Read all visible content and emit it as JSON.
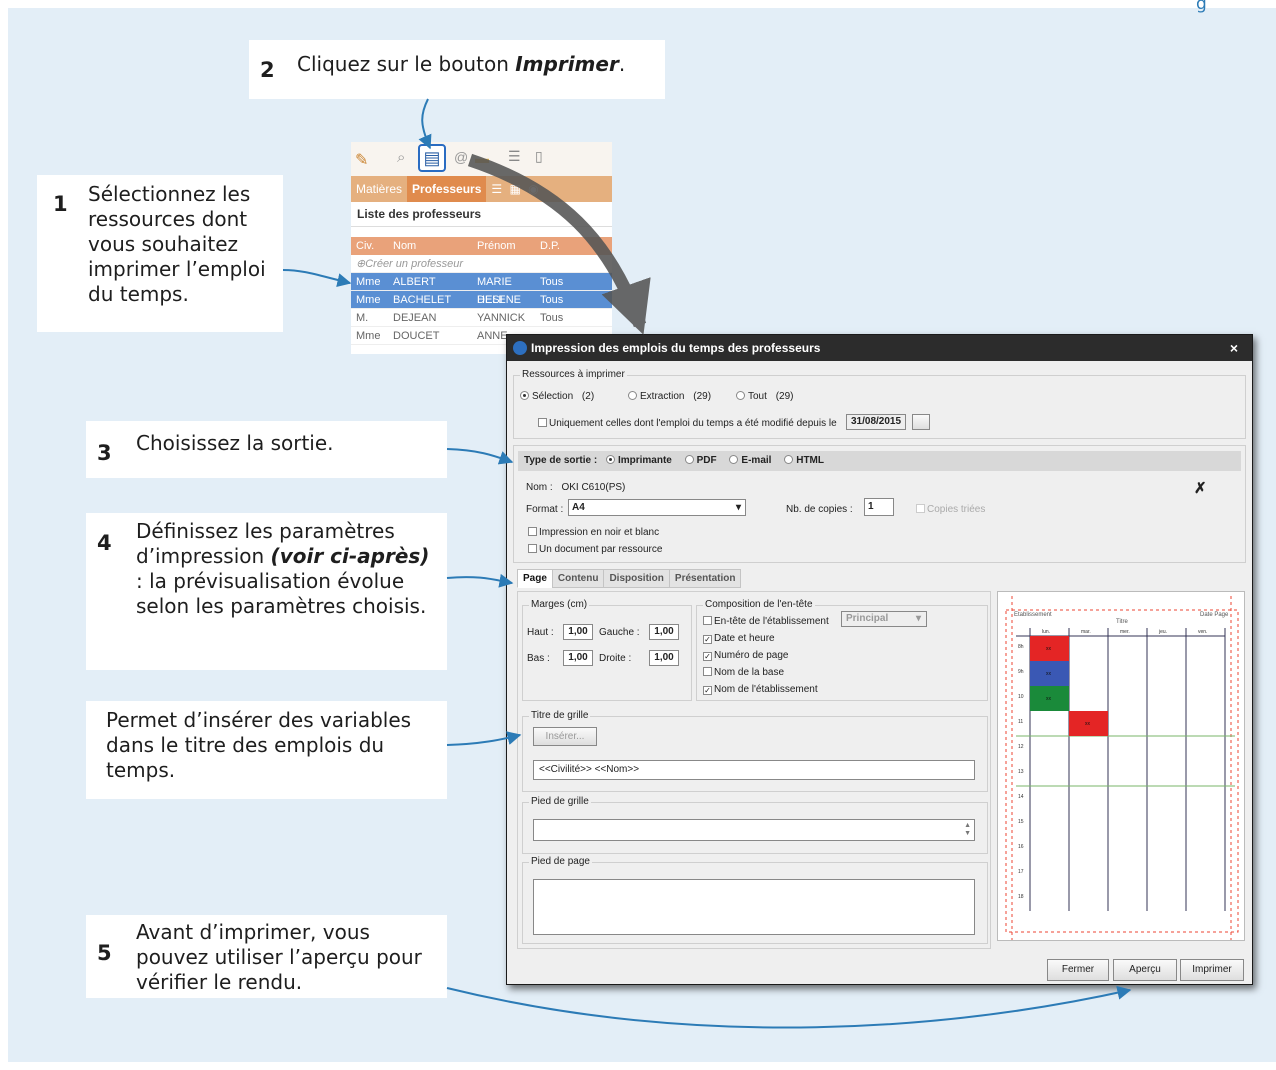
{
  "corner_text": "g",
  "steps": [
    {
      "num": "1",
      "text": "Sélectionnez les ressources dont vous souhaitez imprimer l’emploi du temps."
    },
    {
      "num": "2",
      "pre": "Cliquez sur le bouton ",
      "bold": "Imprimer",
      "post": "."
    },
    {
      "num": "3",
      "text": "Choisissez la sortie."
    },
    {
      "num": "4",
      "pre": "Définissez les paramètres d’impression ",
      "bold": "(voir ci-après)",
      "post": " : la prévisualisation évolue selon les paramètres choisis."
    },
    {
      "num": "",
      "text": "Permet d’insérer des variables dans le titre des emplois du temps."
    },
    {
      "num": "5",
      "text": "Avant d’imprimer, vous pouvez utiliser l’aperçu pour vérifier le rendu."
    }
  ],
  "mini": {
    "tab1": "Matières",
    "tab2": "Professeurs",
    "list_title": "Liste des professeurs",
    "columns": [
      "Civ.",
      "Nom",
      "Prénom",
      "D.P."
    ],
    "create": "Créer un professeur",
    "rows": [
      [
        "Mme",
        "ALBERT",
        "MARIE DESI",
        "Tous"
      ],
      [
        "Mme",
        "BACHELET",
        "HELENE",
        "Tous"
      ],
      [
        "M.",
        "DEJEAN",
        "YANNICK",
        "Tous"
      ],
      [
        "Mme",
        "DOUCET",
        "ANNE",
        ""
      ]
    ]
  },
  "dialog": {
    "title": "Impression des emplois du temps des professeurs",
    "close": "×",
    "res_legend": "Ressources à imprimer",
    "r_sel": "Sélection",
    "r_sel_n": "(2)",
    "r_ext": "Extraction",
    "r_ext_n": "(29)",
    "r_tout": "Tout",
    "r_tout_n": "(29)",
    "modified": "Uniquement celles dont l'emploi du temps a été modifié depuis le",
    "date": "31/08/2015",
    "type_label": "Type de sortie :",
    "t1": "Imprimante",
    "t2": "PDF",
    "t3": "E-mail",
    "t4": "HTML",
    "nom_label": "Nom :",
    "nom": "OKI C610(PS)",
    "format_label": "Format :",
    "format": "A4",
    "copies_label": "Nb. de copies :",
    "copies": "1",
    "copies_triees": "Copies triées",
    "noir": "Impression en noir et blanc",
    "doc": "Un document par ressource",
    "tabs": [
      "Page",
      "Contenu",
      "Disposition",
      "Présentation"
    ],
    "marges": "Marges (cm)",
    "haut": "Haut :",
    "haut_v": "1,00",
    "gauche": "Gauche :",
    "gauche_v": "1,00",
    "bas": "Bas :",
    "bas_v": "1,00",
    "droite": "Droite :",
    "droite_v": "1,00",
    "compo": "Composition de l'en-tête",
    "entete": "En-tête de l'établissement",
    "principal": "Principal",
    "c_date": "Date et heure",
    "c_num": "Numéro de page",
    "c_base": "Nom de la base",
    "c_etab": "Nom de l'établissement",
    "titre_grille": "Titre de grille",
    "inserer": "Insérer...",
    "titre_value": "<<Civilité>> <<Nom>>",
    "pied_grille": "Pied de grille",
    "pied_page": "Pied de page",
    "b_fermer": "Fermer",
    "b_apercu": "Aperçu",
    "b_imprimer": "Imprimer",
    "pv": {
      "etab": "Etablissement",
      "date": "Date Page",
      "titre": "Titre",
      "days": [
        "lun.",
        "mar.",
        "mer.",
        "jeu.",
        "ven."
      ],
      "hours": [
        "8h",
        "9h",
        "10",
        "11",
        "12",
        "13",
        "14",
        "15",
        "16",
        "17",
        "18"
      ],
      "cell": "xx"
    }
  },
  "colors": {
    "bg": "#e3eef7",
    "arrow": "#2c7bb6",
    "red": "#e42525",
    "blue": "#3a58b4",
    "green": "#1a8a3a"
  }
}
